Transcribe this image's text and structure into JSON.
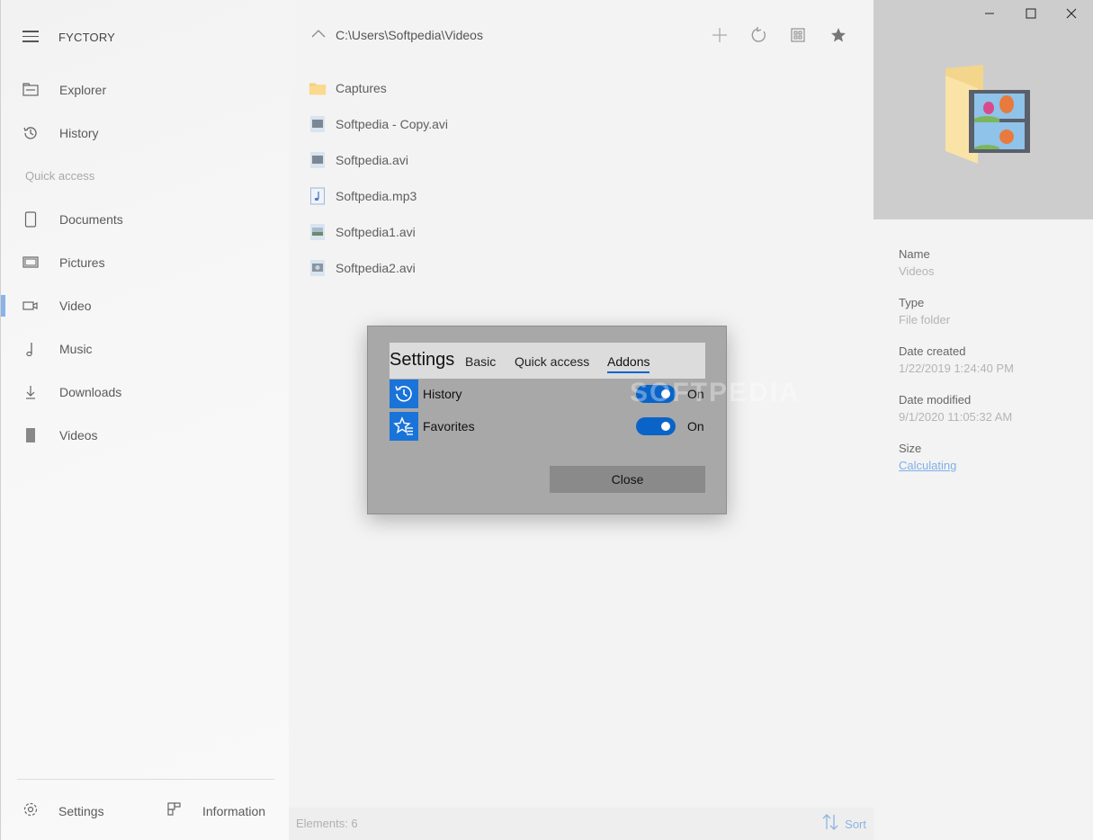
{
  "app": {
    "title": "FYCTORY"
  },
  "sidebar": {
    "nav": [
      {
        "label": "Explorer",
        "icon": "explorer-icon"
      },
      {
        "label": "History",
        "icon": "history-icon"
      }
    ],
    "quick_access_label": "Quick access",
    "quick_access": [
      {
        "label": "Documents",
        "icon": "document-icon"
      },
      {
        "label": "Pictures",
        "icon": "pictures-icon"
      },
      {
        "label": "Video",
        "icon": "video-icon",
        "active": true
      },
      {
        "label": "Music",
        "icon": "music-icon"
      },
      {
        "label": "Downloads",
        "icon": "download-icon"
      },
      {
        "label": "Videos",
        "icon": "videos-folder-icon"
      }
    ],
    "bottom": {
      "settings_label": "Settings",
      "information_label": "Information"
    }
  },
  "main": {
    "path": "C:\\Users\\Softpedia\\Videos",
    "toolbar": [
      "add-icon",
      "refresh-icon",
      "view-grid-icon",
      "star-icon"
    ],
    "files": [
      {
        "name": "Captures",
        "icon": "folder-icon"
      },
      {
        "name": "Softpedia - Copy.avi",
        "icon": "video-file-icon"
      },
      {
        "name": "Softpedia.avi",
        "icon": "video-file-icon"
      },
      {
        "name": "Softpedia.mp3",
        "icon": "audio-file-icon"
      },
      {
        "name": "Softpedia1.avi",
        "icon": "video-file-icon"
      },
      {
        "name": "Softpedia2.avi",
        "icon": "video-file-icon"
      }
    ],
    "status": "Elements: 6",
    "sort_label": "Sort"
  },
  "details": {
    "properties": [
      {
        "key": "Name",
        "value": "Videos"
      },
      {
        "key": "Type",
        "value": "File folder"
      },
      {
        "key": "Date created",
        "value": "1/22/2019 1:24:40 PM"
      },
      {
        "key": "Date modified",
        "value": "9/1/2020 11:05:32 AM"
      },
      {
        "key": "Size",
        "value": "Calculating"
      }
    ]
  },
  "dialog": {
    "title": "Settings",
    "tabs": [
      "Basic",
      "Quick access",
      "Addons"
    ],
    "active_tab": "Addons",
    "addons": [
      {
        "label": "History",
        "state": "On",
        "icon": "history-icon"
      },
      {
        "label": "Favorites",
        "state": "On",
        "icon": "favorites-icon"
      }
    ],
    "close_label": "Close"
  },
  "watermark": "SOFTPEDIA",
  "colors": {
    "accent": "#0a64c8",
    "addon_icon_bg": "#1a73d8",
    "link": "#7fb0e8"
  }
}
